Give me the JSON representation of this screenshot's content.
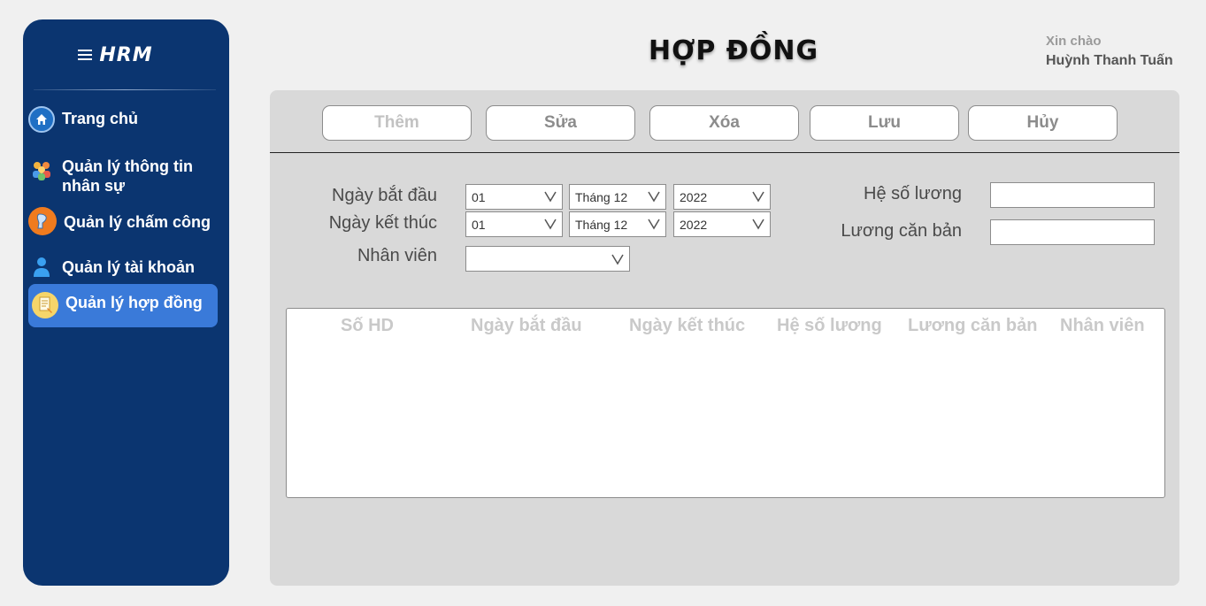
{
  "brand": {
    "logo_text": "HRM"
  },
  "sidebar": {
    "items": [
      {
        "label": "Trang chủ",
        "icon": "home-icon"
      },
      {
        "label": "Quản lý thông tin nhân sự",
        "icon": "people-icon"
      },
      {
        "label": "Quản lý chấm công",
        "icon": "timekeeping-icon"
      },
      {
        "label": "Quản lý tài khoản",
        "icon": "user-icon"
      },
      {
        "label": "Quản lý hợp đồng",
        "icon": "contract-icon",
        "active": true
      }
    ]
  },
  "header": {
    "title": "HỢP ĐỒNG",
    "greeting": "Xin chào",
    "user_name": "Huỳnh Thanh Tuấn"
  },
  "toolbar": {
    "add": "Thêm",
    "edit": "Sửa",
    "delete": "Xóa",
    "save": "Lưu",
    "cancel": "Hủy"
  },
  "form": {
    "start_date_label": "Ngày bắt đầu",
    "end_date_label": "Ngày kết thúc",
    "employee_label": "Nhân viên",
    "salary_coef_label": "Hệ số lương",
    "base_salary_label": "Lương căn bản",
    "start_day": "01",
    "start_month": "Tháng 12",
    "start_year": "2022",
    "end_day": "01",
    "end_month": "Tháng 12",
    "end_year": "2022",
    "employee": "",
    "salary_coef": "",
    "base_salary": ""
  },
  "table": {
    "columns": [
      "Số HD",
      "Ngày bắt đầu",
      "Ngày kết thúc",
      "Hệ số lương",
      "Lương căn bản",
      "Nhân viên"
    ],
    "rows": []
  },
  "colors": {
    "sidebar_bg": "#0b3570",
    "active_item": "#3a7ad9",
    "panel_bg": "#d9d9d9",
    "page_bg": "#f0f0f0"
  }
}
